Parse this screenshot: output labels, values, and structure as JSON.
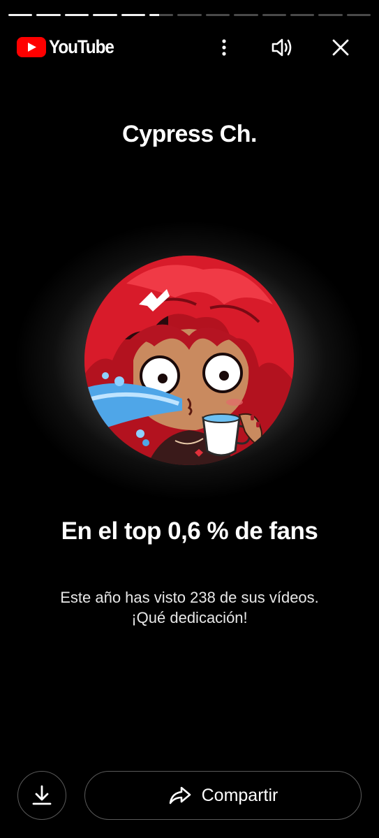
{
  "progress": {
    "segments": [
      1,
      1,
      1,
      1,
      1,
      0.4,
      0,
      0,
      0,
      0,
      0,
      0,
      0
    ]
  },
  "header": {
    "brand": "YouTube",
    "brand_color": "#FF0000",
    "icons": [
      "more-vert-icon",
      "volume-icon",
      "close-icon"
    ]
  },
  "story": {
    "channel_name": "Cypress Ch.",
    "headline": "En el top 0,6 % de fans",
    "description_line1": "Este año has visto 238 de sus vídeos.",
    "description_line2": "¡Qué dedicación!"
  },
  "actions": {
    "download_icon": "download-icon",
    "share_icon": "share-icon",
    "share_label": "Compartir"
  }
}
